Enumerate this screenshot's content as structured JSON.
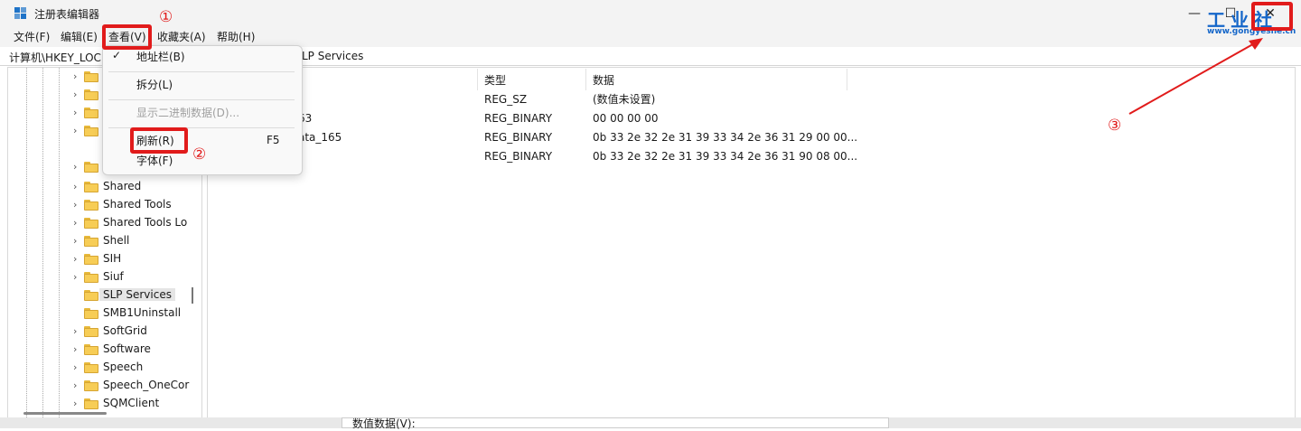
{
  "window": {
    "title": "注册表编辑器"
  },
  "menubar": {
    "items": [
      "文件(F)",
      "编辑(E)",
      "查看(V)",
      "收藏夹(A)",
      "帮助(H)"
    ]
  },
  "address": {
    "prefix": "计算机\\HKEY_LOC",
    "suffix": "LP Services"
  },
  "tree": {
    "items": [
      "",
      "",
      "",
      "",
      "",
      "Shared",
      "Shared Tools",
      "Shared Tools Lo",
      "Shell",
      "SIH",
      "Siuf",
      "SLP Services",
      "SMB1Uninstall",
      "SoftGrid",
      "Software",
      "Speech",
      "Speech_OneCor",
      "SQMClient"
    ]
  },
  "list": {
    "headers": {
      "type": "类型",
      "data": "数据"
    },
    "rows": [
      {
        "name": "",
        "type": "REG_SZ",
        "data": "(数值未设置)"
      },
      {
        "name": "63",
        "type": "REG_BINARY",
        "data": "00 00 00 00"
      },
      {
        "name": "ata_165",
        "type": "REG_BINARY",
        "data": "0b 33 2e 32 2e 31 39 33 34 2e 36 31 29 00 00..."
      },
      {
        "name": "",
        "type": "REG_BINARY",
        "data": "0b 33 2e 32 2e 31 39 33 34 2e 36 31 90 08 00..."
      }
    ]
  },
  "view_menu": {
    "items": [
      {
        "label": "地址栏(B)",
        "checked": true
      },
      {
        "label": "拆分(L)"
      },
      {
        "label": "显示二进制数据(D)...",
        "disabled": true
      },
      {
        "label": "刷新(R)",
        "shortcut": "F5"
      },
      {
        "label": "字体(F)"
      }
    ]
  },
  "annotations": {
    "one": "①",
    "two": "②",
    "three": "③"
  },
  "watermark": {
    "title": "工业社",
    "site": "www.gongyeshe.cn"
  },
  "bottom": {
    "text": "数值数据(V):"
  },
  "colors": {
    "highlight": "#e11b1b",
    "folder": "#f7cd56",
    "brand": "#1466c9"
  }
}
